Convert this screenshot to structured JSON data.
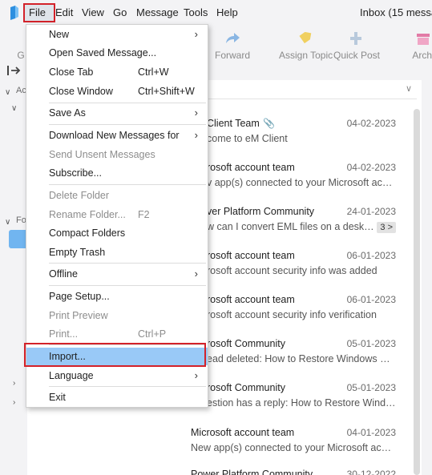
{
  "menubar": {
    "items": [
      {
        "label": "File"
      },
      {
        "label": "Edit"
      },
      {
        "label": "View"
      },
      {
        "label": "Go"
      },
      {
        "label": "Message"
      },
      {
        "label": "Tools"
      },
      {
        "label": "Help"
      }
    ],
    "window_title": "Inbox (15 messag"
  },
  "toolbar": {
    "left_partial": "G",
    "forward": "Forward",
    "assign_topic": "Assign Topic",
    "quick_post": "Quick Post",
    "archive_partial": "Archi"
  },
  "sidebar": {
    "accounts_partial": "Ac",
    "folders_partial": "Fo"
  },
  "file_menu": {
    "items": [
      {
        "label": "New",
        "shortcut": "",
        "submenu": true,
        "disabled": false
      },
      {
        "label": "Open Saved Message...",
        "shortcut": "",
        "submenu": false,
        "disabled": false
      },
      {
        "label": "Close Tab",
        "shortcut": "Ctrl+W",
        "submenu": false,
        "disabled": false
      },
      {
        "label": "Close Window",
        "shortcut": "Ctrl+Shift+W",
        "submenu": false,
        "disabled": false
      },
      {
        "label": "Save As",
        "shortcut": "",
        "submenu": true,
        "disabled": false
      },
      {
        "label": "Download New Messages for",
        "shortcut": "",
        "submenu": true,
        "disabled": false
      },
      {
        "label": "Send Unsent Messages",
        "shortcut": "",
        "submenu": false,
        "disabled": true
      },
      {
        "label": "Subscribe...",
        "shortcut": "",
        "submenu": false,
        "disabled": false
      },
      {
        "label": "Delete Folder",
        "shortcut": "",
        "submenu": false,
        "disabled": true
      },
      {
        "label": "Rename Folder...",
        "shortcut": "F2",
        "submenu": false,
        "disabled": true
      },
      {
        "label": "Compact Folders",
        "shortcut": "",
        "submenu": false,
        "disabled": false
      },
      {
        "label": "Empty Trash",
        "shortcut": "",
        "submenu": false,
        "disabled": false
      },
      {
        "label": "Offline",
        "shortcut": "",
        "submenu": true,
        "disabled": false
      },
      {
        "label": "Page Setup...",
        "shortcut": "",
        "submenu": false,
        "disabled": false
      },
      {
        "label": "Print Preview",
        "shortcut": "",
        "submenu": false,
        "disabled": true
      },
      {
        "label": "Print...",
        "shortcut": "Ctrl+P",
        "submenu": false,
        "disabled": true
      },
      {
        "label": "Import...",
        "shortcut": "",
        "submenu": false,
        "disabled": false
      },
      {
        "label": "Language",
        "shortcut": "",
        "submenu": true,
        "disabled": false
      },
      {
        "label": "Exit",
        "shortcut": "",
        "submenu": false,
        "disabled": false
      }
    ]
  },
  "messages": [
    {
      "sender": "Client Team",
      "date": "04-02-2023",
      "subject": "come to eM Client"
    },
    {
      "sender": "rosoft account team",
      "date": "04-02-2023",
      "subject": "v app(s) connected to your Microsoft accou..."
    },
    {
      "sender": "ver Platform Community",
      "date": "24-01-2023",
      "subject": "w can I convert EML files on a deskt...",
      "count": "3 >"
    },
    {
      "sender": "rosoft account team",
      "date": "06-01-2023",
      "subject": "rosoft account security info was added"
    },
    {
      "sender": "rosoft account team",
      "date": "06-01-2023",
      "subject": "rosoft account security info verification"
    },
    {
      "sender": "rosoft Community",
      "date": "05-01-2023",
      "subject": "ead deleted: How to Restore Windows XP B..."
    },
    {
      "sender": "rosoft Community",
      "date": "05-01-2023",
      "subject": "estion has a reply: How to Restore Windows..."
    },
    {
      "sender": "Microsoft account team",
      "date": "04-01-2023",
      "subject": "New app(s) connected to your Microsoft accou..."
    },
    {
      "sender": "Power Platform Community",
      "date": "30-12-2022",
      "subject": ""
    }
  ],
  "colors": {
    "highlight_border": "#d3222a",
    "menu_highlight": "#99c9f7",
    "accent_blue": "#71b5f0"
  }
}
